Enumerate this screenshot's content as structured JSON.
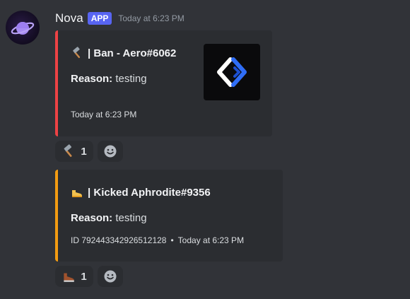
{
  "message": {
    "author": "Nova",
    "badge": "APP",
    "timestamp": "Today at 6:23 PM"
  },
  "embeds": [
    {
      "title": "| Ban - Aero#6062",
      "title_icon": "hammer-icon",
      "reason_label": "Reason:",
      "reason_value": "testing",
      "footer_time": "Today at 6:23 PM",
      "accent_color": "#ed4245",
      "thumbnail_icon": "code-brackets-logo"
    },
    {
      "title": "| Kicked Aphrodite#9356",
      "title_icon": "boot-icon",
      "reason_label": "Reason:",
      "reason_value": "testing",
      "footer_id": "ID 792443342926512128",
      "footer_sep": "•",
      "footer_time": "Today at 6:23 PM",
      "accent_color": "#f39c12"
    }
  ],
  "reactions": [
    {
      "icon": "hammer-icon",
      "count": "1"
    },
    {
      "icon": "boot-icon",
      "count": "1"
    }
  ],
  "add_reaction_icon": "smiley-add-reaction-icon",
  "colors": {
    "background": "#313338",
    "embed_background": "#2b2d31",
    "badge": "#5865f2"
  }
}
